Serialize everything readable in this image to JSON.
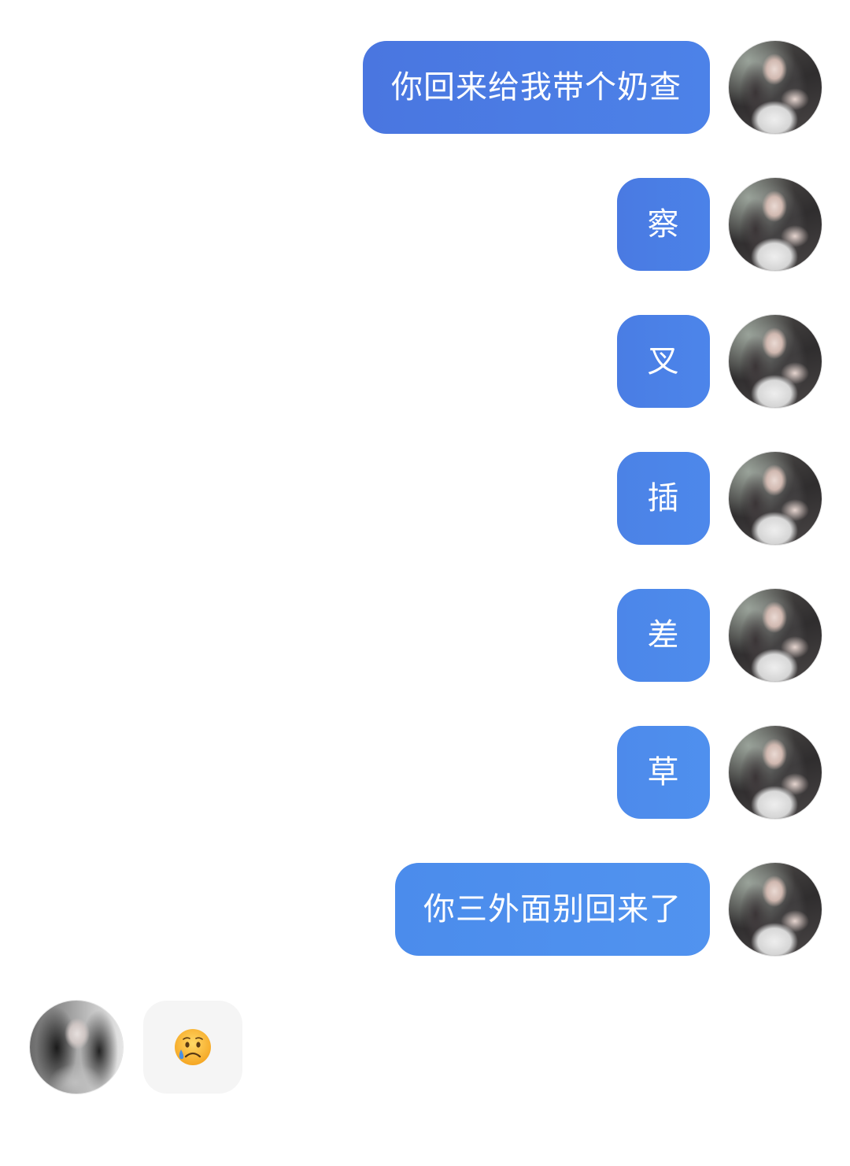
{
  "theme": {
    "outgoing_gradient": [
      "#4a7ae2",
      "#4f93ee"
    ],
    "incoming_bubble": "#f5f5f5",
    "text_out": "#ffffff"
  },
  "messages": [
    {
      "from": "me",
      "text": "你回来给我带个奶查"
    },
    {
      "from": "me",
      "text": "察"
    },
    {
      "from": "me",
      "text": "叉"
    },
    {
      "from": "me",
      "text": "插"
    },
    {
      "from": "me",
      "text": "差"
    },
    {
      "from": "me",
      "text": "草"
    },
    {
      "from": "me",
      "text": "你三外面别回来了"
    },
    {
      "from": "other",
      "emoji": "sad-but-relieved-face"
    }
  ]
}
